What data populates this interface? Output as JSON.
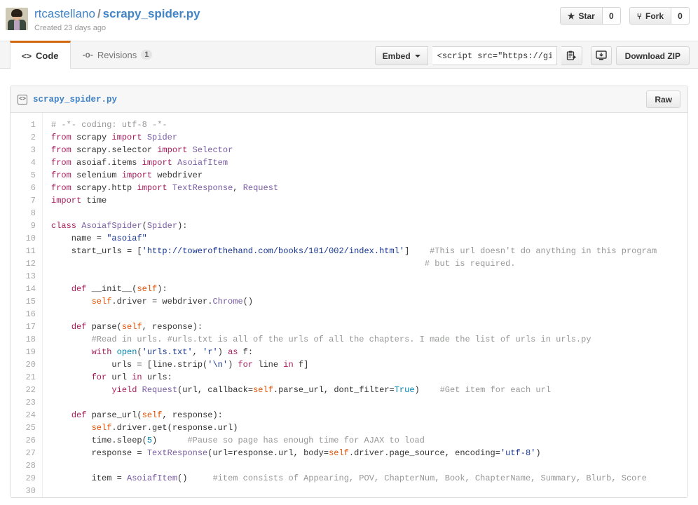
{
  "header": {
    "owner": "rtcastellano",
    "separator": "/",
    "filename": "scrapy_spider.py",
    "created": "Created 23 days ago",
    "avatar_name": "user-avatar",
    "star_label": "Star",
    "star_count": "0",
    "star_icon": "★",
    "fork_label": "Fork",
    "fork_count": "0",
    "fork_icon": "⑂"
  },
  "tabs": [
    {
      "label": "Code",
      "icon": "<>",
      "badge": "",
      "active": true
    },
    {
      "label": "Revisions",
      "icon": "-o-",
      "badge": "1",
      "active": false
    }
  ],
  "toolbar": {
    "embed_label": "Embed",
    "embed_value": "<script src=\"https://gist",
    "copy_icon": "clipboard-icon",
    "download_icon": "download-icon",
    "zip_label": "Download ZIP"
  },
  "file": {
    "code_icon": "<>",
    "name": "scrapy_spider.py",
    "raw_label": "Raw"
  },
  "code": {
    "line_numbers": [
      "1",
      "2",
      "3",
      "4",
      "5",
      "6",
      "7",
      "8",
      "9",
      "10",
      "11",
      "12",
      "13",
      "14",
      "15",
      "16",
      "17",
      "18",
      "19",
      "20",
      "21",
      "22",
      "23",
      "24",
      "25",
      "26",
      "27",
      "28",
      "29",
      "30"
    ],
    "lines": [
      "# -*- coding: utf-8 -*-",
      "from scrapy import Spider",
      "from scrapy.selector import Selector",
      "from asoiaf.items import AsoiafItem",
      "from selenium import webdriver",
      "from scrapy.http import TextResponse, Request",
      "import time",
      "",
      "class AsoiafSpider(Spider):",
      "    name = \"asoiaf\"",
      "    start_urls = ['http://towerofthehand.com/books/101/002/index.html']    #This url doesn't do anything in this program",
      "                                                                          # but is required.",
      "",
      "    def __init__(self):",
      "        self.driver = webdriver.Chrome()",
      "",
      "    def parse(self, response):",
      "        #Read in urls. #urls.txt is all of the urls of all the chapters. I made the list of urls in urls.py",
      "        with open('urls.txt', 'r') as f:",
      "            urls = [line.strip('\\n') for line in f]",
      "        for url in urls:",
      "            yield Request(url, callback=self.parse_url, dont_filter=True)    #Get item for each url",
      "",
      "    def parse_url(self, response):",
      "        self.driver.get(response.url)",
      "        time.sleep(5)      #Pause so page has enough time for AJAX to load",
      "        response = TextResponse(url=response.url, body=self.driver.page_source, encoding='utf-8')",
      "",
      "        item = AsoiafItem()     #item consists of Appearing, POV, ChapterNum, Book, ChapterName, Summary, Blurb, Score",
      ""
    ]
  },
  "colors": {
    "accent_orange": "#d26911",
    "link_blue": "#4183c4",
    "keyword": "#a71d5d",
    "string": "#183691",
    "comment": "#969896",
    "self_kwarg": "#df5000",
    "classname": "#795da3",
    "number": "#0086b3"
  }
}
